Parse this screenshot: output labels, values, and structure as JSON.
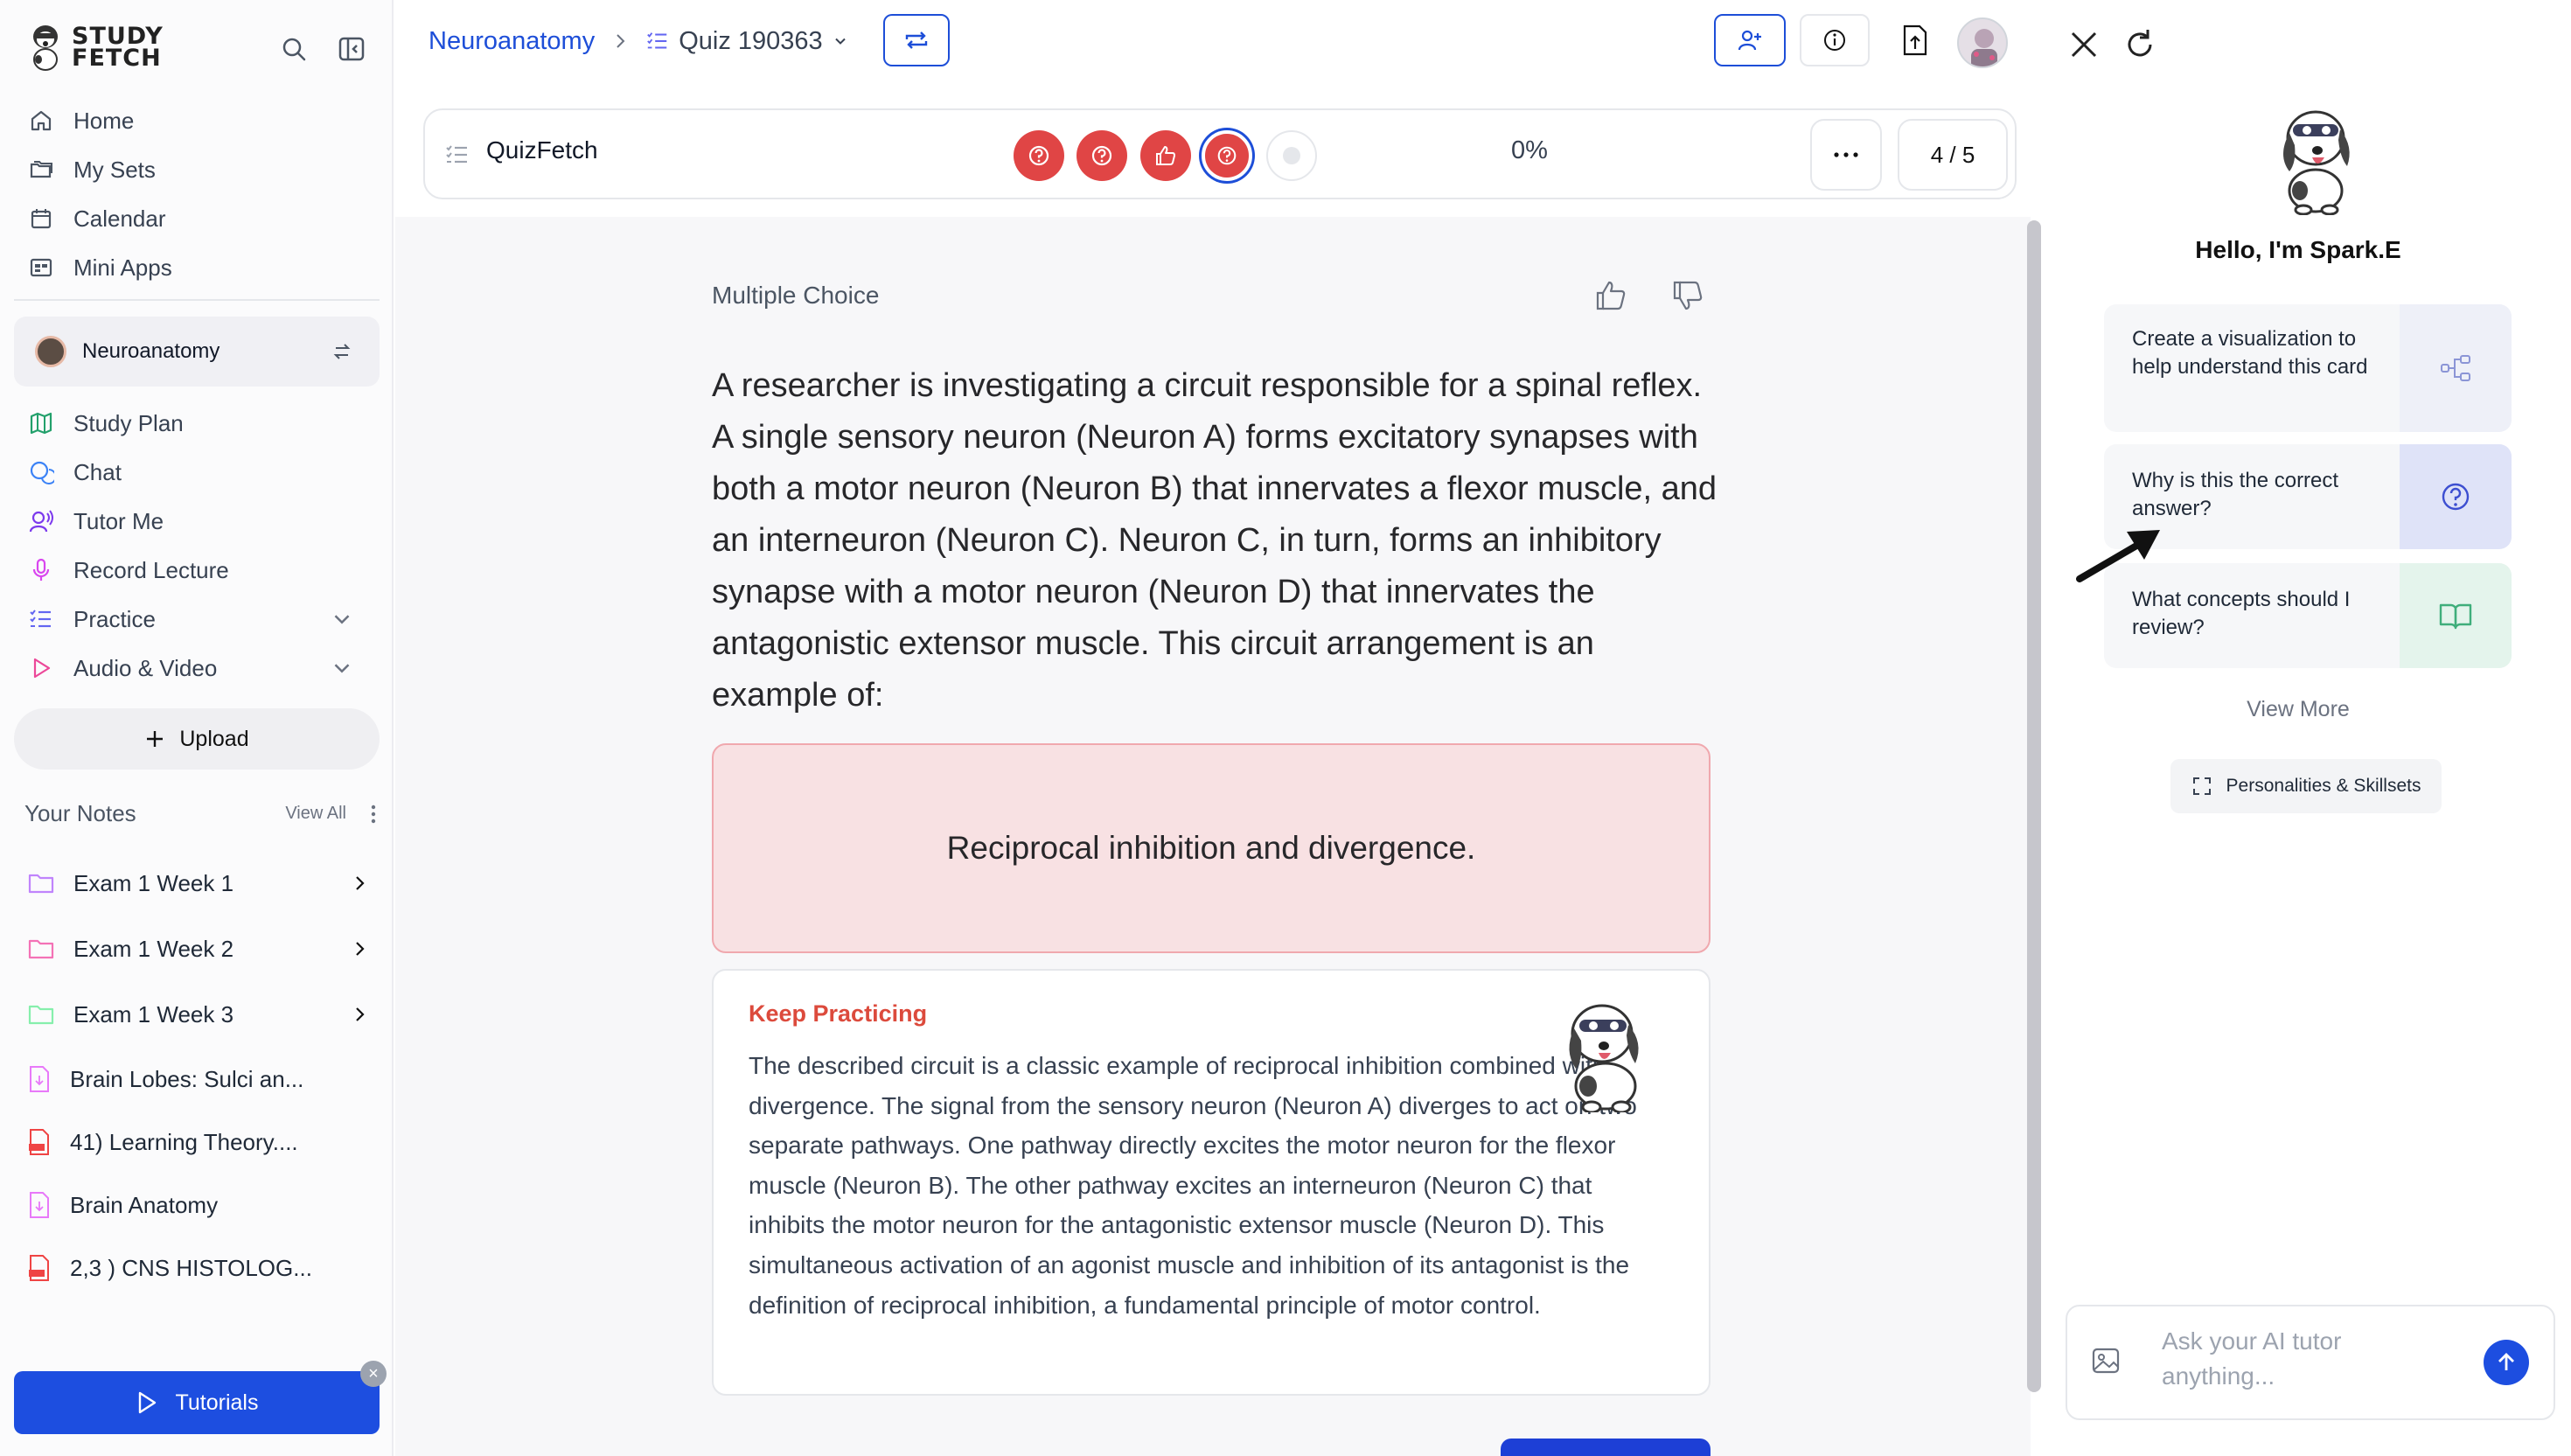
{
  "app": {
    "name": "Study Fetch",
    "logo_line1": "STUDY",
    "logo_line2": "FETCH"
  },
  "sidebar": {
    "nav_top": [
      {
        "label": "Home",
        "icon": "home-icon"
      },
      {
        "label": "My Sets",
        "icon": "folders-icon"
      },
      {
        "label": "Calendar",
        "icon": "calendar-icon"
      },
      {
        "label": "Mini Apps",
        "icon": "apps-icon"
      }
    ],
    "current_set": "Neuroanatomy",
    "nav_set": [
      {
        "label": "Study Plan",
        "icon": "map-icon"
      },
      {
        "label": "Chat",
        "icon": "chat-icon"
      },
      {
        "label": "Tutor Me",
        "icon": "tutor-icon"
      },
      {
        "label": "Record Lecture",
        "icon": "microphone-icon"
      },
      {
        "label": "Practice",
        "icon": "practice-icon"
      },
      {
        "label": "Audio & Video",
        "icon": "play-icon"
      }
    ],
    "upload_label": "Upload",
    "notes_title": "Your Notes",
    "view_all": "View All",
    "notes": [
      {
        "label": "Exam 1 Week 1",
        "type": "folder",
        "color": "#c084fc"
      },
      {
        "label": "Exam 1 Week 2",
        "type": "folder",
        "color": "#f472b6"
      },
      {
        "label": "Exam 1 Week 3",
        "type": "folder",
        "color": "#86efac"
      },
      {
        "label": "Brain Lobes: Sulci an...",
        "type": "doc",
        "color": "#e879f9"
      },
      {
        "label": "41) Learning Theory....",
        "type": "pdf",
        "color": "#ef4444"
      },
      {
        "label": "Brain Anatomy",
        "type": "doc",
        "color": "#e879f9"
      },
      {
        "label": "2,3 ) CNS HISTOLOG...",
        "type": "pdf",
        "color": "#ef4444"
      }
    ],
    "tutorials_label": "Tutorials"
  },
  "header": {
    "breadcrumb_set": "Neuroanatomy",
    "breadcrumb_quiz": "Quiz 190363"
  },
  "quizbar": {
    "title": "QuizFetch",
    "progress": "0%",
    "counter": "4 / 5",
    "question_status": [
      "incorrect",
      "incorrect",
      "correct",
      "current",
      "unanswered"
    ]
  },
  "question": {
    "type": "Multiple Choice",
    "text": "A researcher is investigating a circuit responsible for a spinal reflex. A single sensory neuron (Neuron A) forms excitatory synapses with both a motor neuron (Neuron B) that innervates a flexor muscle, and an interneuron (Neuron C). Neuron C, in turn, forms an inhibitory synapse with a motor neuron (Neuron D) that innervates the antagonistic extensor muscle. This circuit arrangement is an example of:",
    "selected_answer": "Reciprocal inhibition and divergence.",
    "feedback_title": "Keep Practicing",
    "feedback_text": "The described circuit is a classic example of reciprocal inhibition combined with divergence. The signal from the sensory neuron (Neuron A) diverges to act on two separate pathways. One pathway directly excites the motor neuron for the flexor muscle (Neuron B). The other pathway excites an interneuron (Neuron C) that inhibits the motor neuron for the antagonistic extensor muscle (Neuron D). This simultaneous activation of an agonist muscle and inhibition of its antagonist is the definition of reciprocal inhibition, a fundamental principle of motor control."
  },
  "assistant": {
    "greeting": "Hello, I'm Spark.E",
    "suggestions": [
      {
        "label": "Create a visualization to help understand this card",
        "icon": "diagram-icon"
      },
      {
        "label": "Why is this the correct answer?",
        "icon": "question-circle-icon"
      },
      {
        "label": "What concepts should I review?",
        "icon": "book-icon"
      }
    ],
    "view_more": "View More",
    "personalities": "Personalities & Skillsets",
    "input_placeholder": "Ask your AI tutor anything...",
    "input_value": ""
  },
  "colors": {
    "accent": "#1d4ee0",
    "incorrect": "#e04545",
    "answer_bg": "#f8e1e3",
    "feedback_title": "#dc4a3c"
  }
}
